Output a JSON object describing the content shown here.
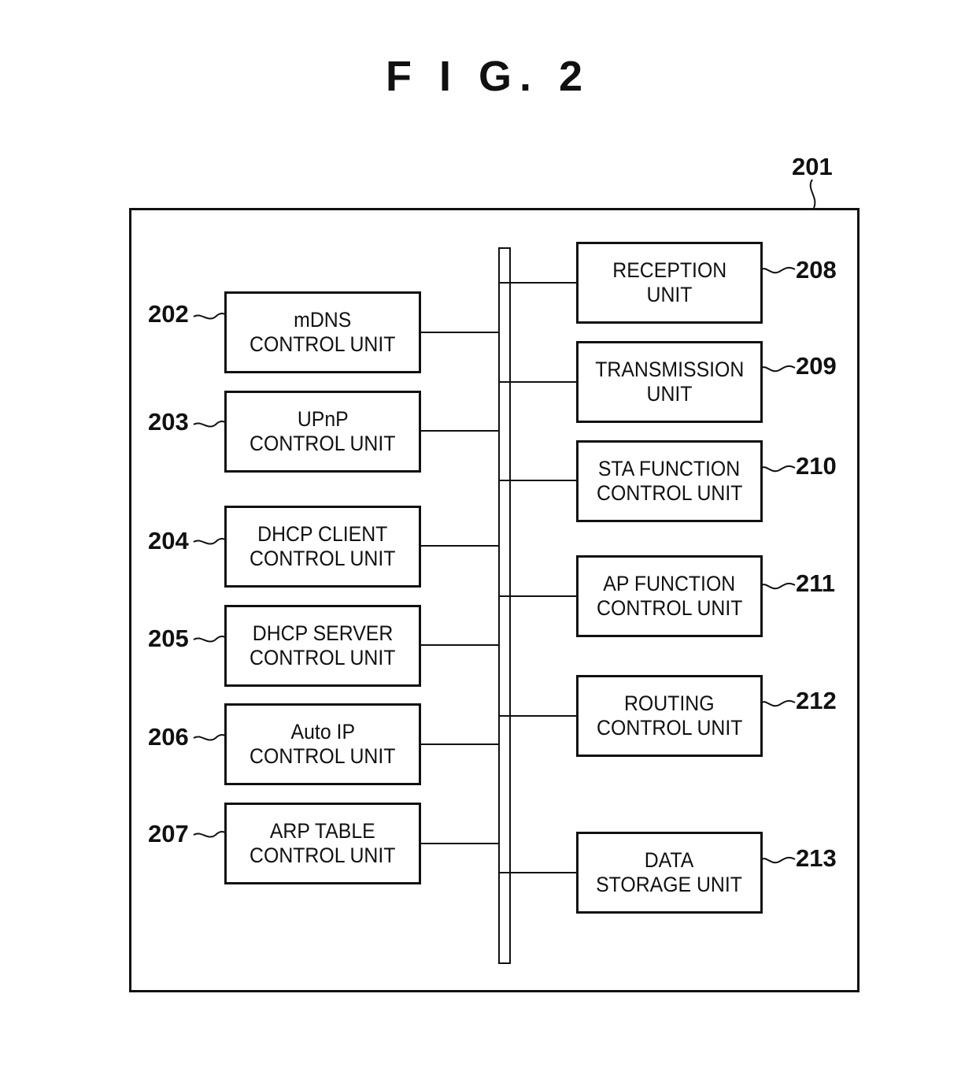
{
  "figure": {
    "title": "F I G. 2",
    "container_ref": "201"
  },
  "left_units": [
    {
      "ref": "202",
      "line1": "mDNS",
      "line2": "CONTROL UNIT"
    },
    {
      "ref": "203",
      "line1": "UPnP",
      "line2": "CONTROL UNIT"
    },
    {
      "ref": "204",
      "line1": "DHCP CLIENT",
      "line2": "CONTROL UNIT"
    },
    {
      "ref": "205",
      "line1": "DHCP SERVER",
      "line2": "CONTROL UNIT"
    },
    {
      "ref": "206",
      "line1": "Auto IP",
      "line2": "CONTROL UNIT"
    },
    {
      "ref": "207",
      "line1": "ARP TABLE",
      "line2": "CONTROL UNIT"
    }
  ],
  "right_units": [
    {
      "ref": "208",
      "line1": "RECEPTION",
      "line2": "UNIT"
    },
    {
      "ref": "209",
      "line1": "TRANSMISSION",
      "line2": "UNIT"
    },
    {
      "ref": "210",
      "line1": "STA FUNCTION",
      "line2": "CONTROL UNIT"
    },
    {
      "ref": "211",
      "line1": "AP FUNCTION",
      "line2": "CONTROL UNIT"
    },
    {
      "ref": "212",
      "line1": "ROUTING",
      "line2": "CONTROL UNIT"
    },
    {
      "ref": "213",
      "line1": "DATA",
      "line2": "STORAGE UNIT"
    }
  ]
}
